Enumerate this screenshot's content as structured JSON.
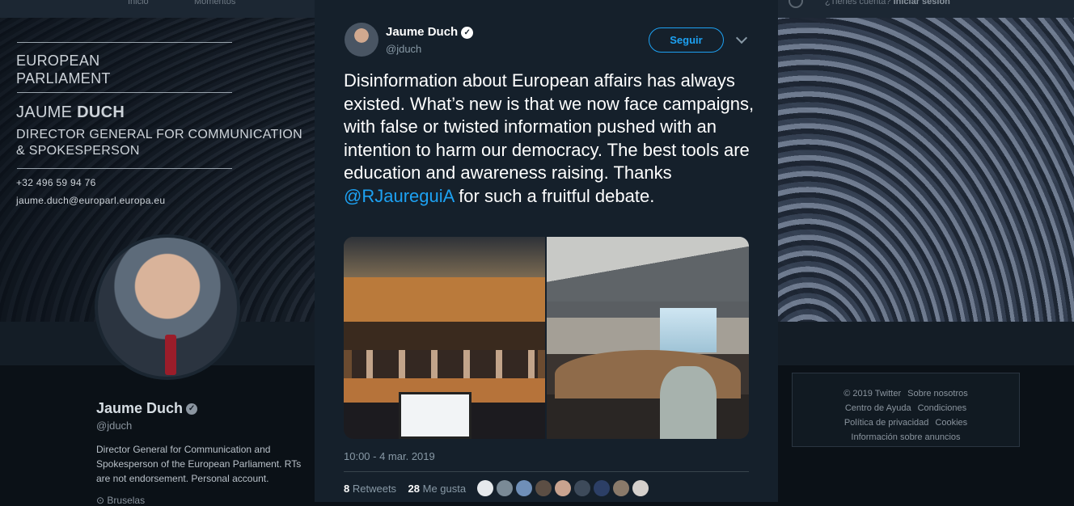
{
  "topnav": {
    "home": "Inicio",
    "moments": "Momentos",
    "login_prompt": "¿Tienes cuenta?",
    "login_link": "Iniciar sesión"
  },
  "banner": {
    "org_line1": "EUROPEAN",
    "org_line2": "PARLIAMENT",
    "name_first": "JAUME ",
    "name_last": "DUCH",
    "role_line1": "DIRECTOR GENERAL FOR COMMUNICATION",
    "role_line2": "& SPOKESPERSON",
    "phone": "+32 496 59 94 76",
    "email": "jaume.duch@europarl.europa.eu"
  },
  "profile": {
    "name": "Jaume Duch",
    "handle": "@jduch",
    "bio": "Director General for Communication and Spokesperson of the European Parliament. RTs are not endorsement. Personal account.",
    "location": "Bruselas"
  },
  "footer": {
    "links": [
      "© 2019 Twitter",
      "Sobre nosotros",
      "Centro de Ayuda",
      "Condiciones",
      "Política de privacidad",
      "Cookies",
      "Información sobre anuncios"
    ]
  },
  "tweet": {
    "author_name": "Jaume Duch",
    "author_handle": "@jduch",
    "follow_label": "Seguir",
    "text_before": "Disinformation about European affairs has always existed. What’s new is that we now face campaigns, with false or twisted information pushed with an intention to harm our democracy. The best tools are education and awareness raising. Thanks ",
    "mention": "@RJaureguiA",
    "text_after": " for such a fruitful debate.",
    "timestamp": "10:00 - 4 mar. 2019",
    "retweets_count": "8",
    "retweets_label": "Retweets",
    "likes_count": "28",
    "likes_label": "Me gusta",
    "liker_colors": [
      "#e6e9ec",
      "#7a8a96",
      "#6f8fb8",
      "#5c4e44",
      "#c9a38f",
      "#3d4a5a",
      "#2c3f66",
      "#8a7a6a",
      "#d5d0cc"
    ]
  }
}
